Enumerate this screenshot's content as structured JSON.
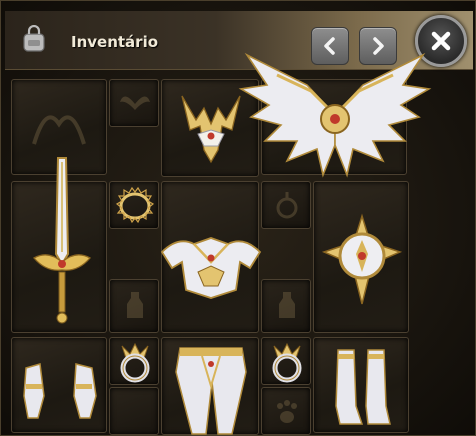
{
  "window": {
    "title": "Inventário",
    "icons": {
      "bag": "backpack-icon",
      "prev": "chevron-left-icon",
      "next": "chevron-right-icon",
      "close": "close-icon"
    }
  },
  "equipment": [
    {
      "slot": "pet",
      "item": "empty"
    },
    {
      "slot": "wings-mini",
      "item": "empty"
    },
    {
      "slot": "helm",
      "item": "golden-winged-helm"
    },
    {
      "slot": "wings",
      "item": "golden-wings"
    },
    {
      "slot": "weapon",
      "item": "golden-sword"
    },
    {
      "slot": "pendant",
      "item": "golden-necklace"
    },
    {
      "slot": "armor",
      "item": "golden-armor"
    },
    {
      "slot": "shield",
      "item": "golden-shield"
    },
    {
      "slot": "gloves",
      "item": "golden-gloves"
    },
    {
      "slot": "ring-left",
      "item": "golden-ring"
    },
    {
      "slot": "pants",
      "item": "golden-pants"
    },
    {
      "slot": "ring-right",
      "item": "golden-ring"
    },
    {
      "slot": "boots",
      "item": "golden-boots"
    }
  ],
  "colors": {
    "gold": "#d8b45a",
    "silver": "#d9d9e0",
    "frame": "#4b4030"
  }
}
